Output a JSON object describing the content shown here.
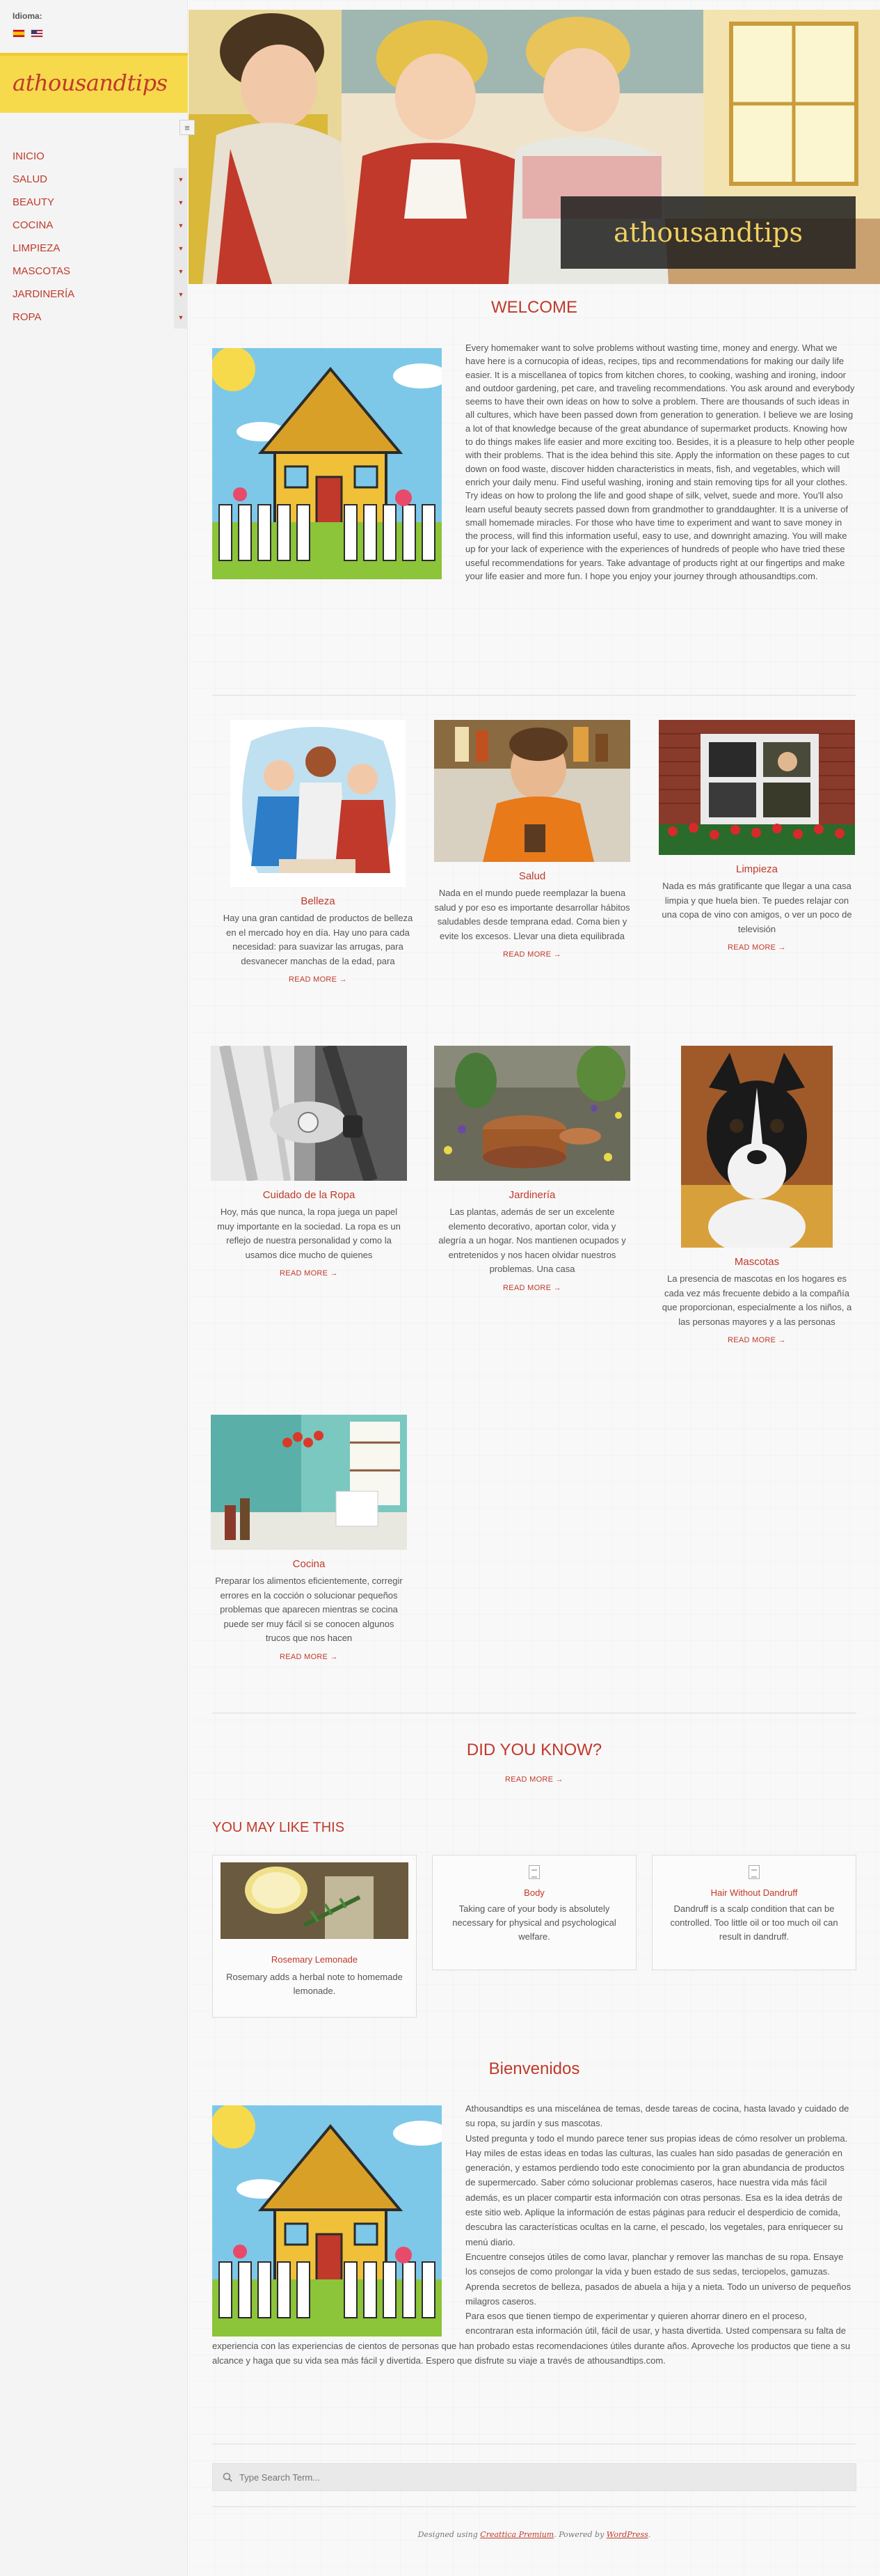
{
  "sidebar": {
    "language_label": "Idioma:",
    "site_title": "athousandtips",
    "nav": [
      {
        "label": "INICIO",
        "has_toggle": false
      },
      {
        "label": "SALUD",
        "has_toggle": true
      },
      {
        "label": "BEAUTY",
        "has_toggle": true
      },
      {
        "label": "COCINA",
        "has_toggle": true
      },
      {
        "label": "LIMPIEZA",
        "has_toggle": true
      },
      {
        "label": "MASCOTAS",
        "has_toggle": true
      },
      {
        "label": "JARDINERÍA",
        "has_toggle": true
      },
      {
        "label": "ROPA",
        "has_toggle": true
      }
    ],
    "menu_button": "≡"
  },
  "hero": {
    "title": "athousandtips"
  },
  "welcome": {
    "title": "WELCOME",
    "text": "Every homemaker want to solve problems without wasting time, money and energy. What we have here is a cornucopia of ideas, recipes, tips and recommendations for making our daily life easier. It is a miscellanea of topics from kitchen chores, to cooking, washing and ironing, indoor and outdoor gardening, pet care, and traveling recommendations. You ask around and everybody seems to have their own ideas on how to solve a problem. There are thousands of such ideas in all cultures, which have been passed down from generation to generation. I believe we are losing a lot of that knowledge because of the great abundance of supermarket products. Knowing how to do things makes life easier and more exciting too. Besides, it is a pleasure to help other people with their problems. That is the idea behind this site. Apply the information on these pages to cut down on food waste, discover hidden characteristics in meats, fish, and vegetables, which will enrich your daily menu. Find useful washing, ironing and stain removing tips for all your clothes. Try ideas on how to prolong the life and good shape of silk, velvet, suede and more. You'll also learn useful beauty secrets passed down from grandmother to granddaughter. It is a universe of small homemade miracles. For those who have time to experiment and want to save money in the process, will find this information useful, easy to use, and downright amazing. You will make up for your lack of experience with the experiences of hundreds of people who have tried these useful recommendations for years. Take advantage of products right at our fingertips and make your life easier and more fun. I hope you enjoy your journey through athousandtips.com."
  },
  "categories": [
    {
      "title": "Belleza",
      "text": "Hay una gran cantidad de productos de belleza en el mercado hoy en día. Hay uno para cada necesidad: para suavizar las arrugas, para desvanecer manchas de la edad, para",
      "more": "READ MORE →"
    },
    {
      "title": "Salud",
      "text": "Nada en el mundo puede reemplazar la buena salud y por eso es importante desarrollar hábitos saludables desde temprana edad. Coma bien y evite los excesos. Llevar una dieta equilibrada",
      "more": "READ MORE →"
    },
    {
      "title": "Limpieza",
      "text": "Nada es más gratificante que llegar a una casa limpia y que huela bien. Te puedes relajar con una copa de vino con amigos, o ver un poco de televisión",
      "more": "READ MORE →"
    },
    {
      "title": "Cuidado de la Ropa",
      "text": "Hoy, más que nunca, la ropa juega un papel muy importante en la sociedad. La ropa es un reflejo de nuestra personalidad y como la usamos dice mucho de quienes",
      "more": "READ MORE →"
    },
    {
      "title": "Jardinería",
      "text": "Las plantas, además de ser un excelente elemento decorativo, aportan color, vida y alegría a un hogar. Nos mantienen ocupados y entretenidos y nos hacen olvidar nuestros problemas. Una casa",
      "more": "READ MORE →"
    },
    {
      "title": "Mascotas",
      "text": "La presencia de mascotas en los hogares es cada vez más frecuente debido a la compañía que proporcionan, especialmente a los niños, a las personas mayores y a las personas",
      "more": "READ MORE →"
    },
    {
      "title": "Cocina",
      "text": "Preparar los alimentos eficientemente, corregir errores en la cocción o solucionar pequeños problemas que aparecen mientras se cocina puede ser muy fácil si se conocen algunos trucos que nos hacen",
      "more": "READ MORE →"
    }
  ],
  "did_you_know": {
    "title": "DID YOU KNOW?",
    "more": "READ MORE →"
  },
  "may_like": {
    "title": "YOU MAY LIKE THIS",
    "items": [
      {
        "title": "Rosemary Lemonade",
        "text": "Rosemary adds a herbal note to homemade lemonade."
      },
      {
        "title": "Body",
        "text": "Taking care of your body is absolutely necessary for physical and psychological welfare."
      },
      {
        "title": "Hair Without Dandruff",
        "text": "Dandruff is a scalp condition that can be controlled. Too little oil or too much oil can result in dandruff."
      }
    ]
  },
  "bienvenidos": {
    "title": "Bienvenidos",
    "p1": "Athousandtips es una miscelánea de temas, desde tareas de cocina, hasta lavado y cuidado de su ropa, su jardín y sus mascotas.",
    "p2": "Usted pregunta y todo el mundo parece tener sus propias ideas de cómo resolver un problema. Hay miles de estas ideas en todas las culturas, las cuales han sido pasadas de generación en generación, y estamos perdiendo todo este conocimiento por la gran abundancia de productos de supermercado. Saber cómo solucionar problemas caseros, hace nuestra vida más fácil además, es un placer compartir esta información con otras personas. Esa es la idea detrás de este sitio web. Aplique la información de estas páginas para reducir el desperdicio de comida, descubra las características ocultas en la carne, el pescado, los vegetales, para enriquecer su menú diario.",
    "p3": "Encuentre consejos útiles de como lavar, planchar y remover las manchas de su ropa. Ensaye los consejos de como prolongar la vida y buen estado de sus sedas, terciopelos, gamuzas. Aprenda secretos de belleza, pasados de abuela a hija y a nieta. Todo un universo de pequeños milagros caseros.",
    "p4": "Para esos que tienen tiempo de experimentar y quieren ahorrar dinero en el proceso, encontraran esta información útil, fácil de usar, y hasta divertida. Usted compensara su falta de experiencia con las experiencias de cientos de personas que han probado estas recomendaciones útiles durante años. Aproveche los productos que tiene a su alcance y haga que su vida sea más fácil y divertida. Espero que disfrute su viaje a través de athousandtips.com."
  },
  "search": {
    "placeholder": "Type Search Term..."
  },
  "footer": {
    "pre": "Designed using ",
    "theme": "Creattica Premium",
    "mid": ". Powered by ",
    "wp": "WordPress",
    "post": "."
  },
  "colors": {
    "accent": "#c0392b",
    "logo_bg": "#f7d94c",
    "hero_title": "#f0d060"
  }
}
